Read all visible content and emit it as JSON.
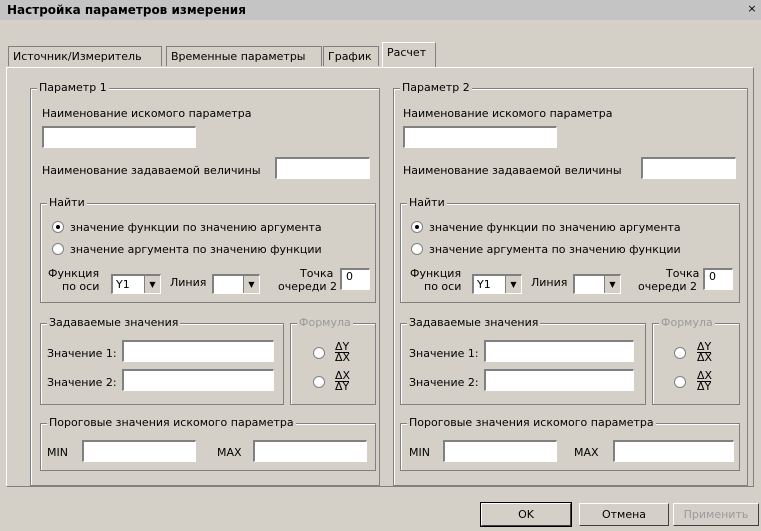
{
  "window": {
    "title": "Настройка параметров измерения",
    "close_glyph": "×"
  },
  "tabs": [
    {
      "label": "Источник/Измеритель"
    },
    {
      "label": "Временные параметры"
    },
    {
      "label": "График"
    },
    {
      "label": "Расчет"
    }
  ],
  "params": [
    {
      "title": "Параметр 1",
      "sought_label": "Наименование искомого параметра",
      "sought_value": "",
      "given_label": "Наименование задаваемой величины",
      "given_value": "",
      "find": {
        "title": "Найти",
        "option1": "значение функции по значению аргумента",
        "option2": "значение аргумента по значению функции",
        "selected": 1,
        "func_axis_label1": "Функция",
        "func_axis_label2": "по оси",
        "func_axis_value": "Y1",
        "line_label": "Линия",
        "line_value": "",
        "point_label1": "Точка",
        "point_label2": "очереди 2",
        "point_value": "0"
      },
      "given_values": {
        "title": "Задаваемые значения",
        "value1_label": "Значение 1:",
        "value1": "",
        "value2_label": "Значение 2:",
        "value2": ""
      },
      "formula": {
        "title": "Формула",
        "f1_num": "ΔY",
        "f1_den": "ΔX",
        "f2_num": "ΔX",
        "f2_den": "ΔY"
      },
      "thresholds": {
        "title": "Пороговые значения искомого параметра",
        "min_label": "MIN",
        "min_value": "",
        "max_label": "MAX",
        "max_value": ""
      }
    },
    {
      "title": "Параметр 2",
      "sought_label": "Наименование искомого параметра",
      "sought_value": "",
      "given_label": "Наименование задаваемой величины",
      "given_value": "",
      "find": {
        "title": "Найти",
        "option1": "значение функции по значению аргумента",
        "option2": "значение аргумента по значению функции",
        "selected": 1,
        "func_axis_label1": "Функция",
        "func_axis_label2": "по оси",
        "func_axis_value": "Y1",
        "line_label": "Линия",
        "line_value": "",
        "point_label1": "Точка",
        "point_label2": "очереди 2",
        "point_value": "0"
      },
      "given_values": {
        "title": "Задаваемые значения",
        "value1_label": "Значение 1:",
        "value1": "",
        "value2_label": "Значение 2:",
        "value2": ""
      },
      "formula": {
        "title": "Формула",
        "f1_num": "ΔY",
        "f1_den": "ΔX",
        "f2_num": "ΔX",
        "f2_den": "ΔY"
      },
      "thresholds": {
        "title": "Пороговые значения искомого параметра",
        "min_label": "MIN",
        "min_value": "",
        "max_label": "MAX",
        "max_value": ""
      }
    }
  ],
  "buttons": {
    "ok": "OK",
    "cancel": "Отмена",
    "apply": "Применить"
  }
}
